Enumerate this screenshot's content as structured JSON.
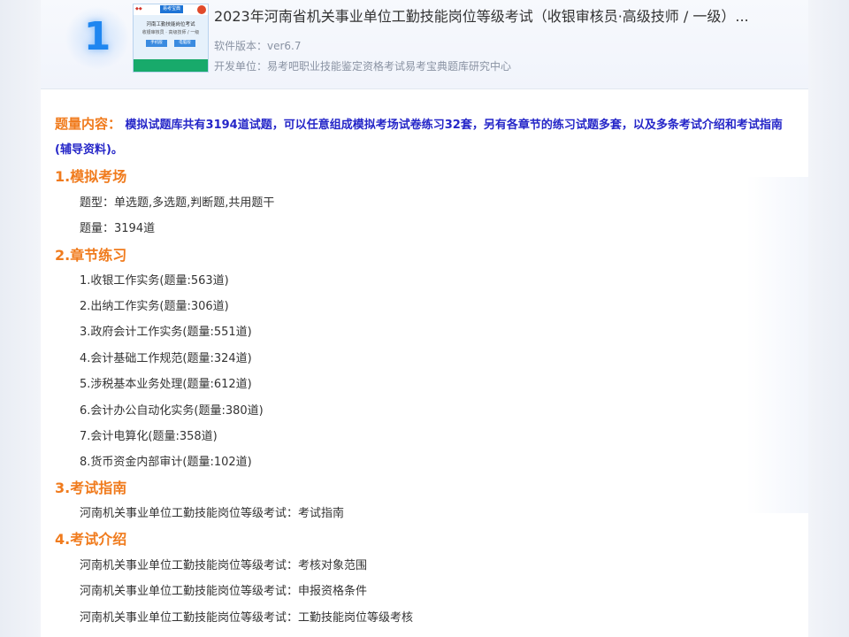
{
  "header": {
    "rank": "1",
    "title": "2023年河南省机关事业单位工勤技能岗位等级考试（收银审核员·高级技师 / 一级）...",
    "version": "软件版本：ver6.7",
    "developer": "开发单位：易考吧职业技能鉴定资格考试易考宝典题库研究中心",
    "cover": {
      "brand": "易考宝典",
      "line1": "河南工勤技能岗位考试",
      "line2": "收银审核员 · 高级技师 / 一级",
      "btn1": "手机版",
      "btn2": "电脑版"
    }
  },
  "intro": {
    "label": "题量内容：",
    "text": "模拟试题库共有3194道试题，可以任意组成模拟考场试卷练习32套，另有各章节的练习试题多套，以及多条考试介绍和考试指南(辅导资料)。"
  },
  "sections": {
    "exam": {
      "title": "1.模拟考场",
      "types": "题型：单选题,多选题,判断题,共用题干",
      "count": "题量：3194道"
    },
    "chapters": {
      "title": "2.章节练习",
      "items": [
        "1.收银工作实务(题量:563道)",
        "2.出纳工作实务(题量:306道)",
        "3.政府会计工作实务(题量:551道)",
        "4.会计基础工作规范(题量:324道)",
        "5.涉税基本业务处理(题量:612道)",
        "6.会计办公自动化实务(题量:380道)",
        "7.会计电算化(题量:358道)",
        "8.货币资金内部审计(题量:102道)"
      ]
    },
    "guide": {
      "title": "3.考试指南",
      "items": [
        "河南机关事业单位工勤技能岗位等级考试：考试指南"
      ]
    },
    "info": {
      "title": "4.考试介绍",
      "items": [
        "河南机关事业单位工勤技能岗位等级考试：考核对象范围",
        "河南机关事业单位工勤技能岗位等级考试：申报资格条件",
        "河南机关事业单位工勤技能岗位等级考试：工勤技能岗位等级考核"
      ]
    }
  },
  "colors": {
    "accent": "#f07b1d",
    "intro_text": "#2526c8",
    "rank": "#1f86f0"
  }
}
